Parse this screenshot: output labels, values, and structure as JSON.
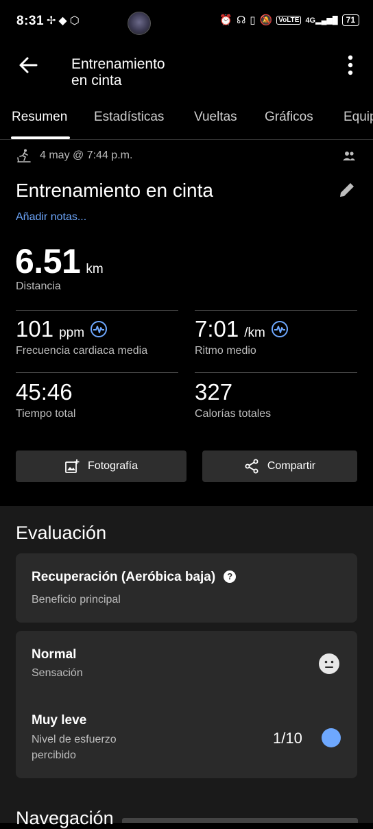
{
  "status_bar": {
    "time": "8:31",
    "left_icons": [
      "fan-icon",
      "badge-icon",
      "shield-icon"
    ],
    "right_icons": [
      "alarm-icon",
      "headphones-icon",
      "vibrate-icon",
      "mute-icon"
    ],
    "volte": "VoLTE",
    "network": "4G",
    "battery": "71"
  },
  "header": {
    "title": "Entrenamiento en cinta"
  },
  "tabs": [
    {
      "label": "Resumen",
      "active": true
    },
    {
      "label": "Estadísticas",
      "active": false
    },
    {
      "label": "Vueltas",
      "active": false
    },
    {
      "label": "Gráficos",
      "active": false
    },
    {
      "label": "Equip",
      "active": false
    }
  ],
  "activity": {
    "datetime": "4 may @ 7:44 p.m.",
    "title": "Entrenamiento en cinta",
    "add_notes": "Añadir notas...",
    "distance_value": "6.51",
    "distance_unit": "km",
    "distance_label": "Distancia",
    "metrics": {
      "heart_rate": {
        "value": "101",
        "unit": "ppm",
        "label": "Frecuencia cardiaca media"
      },
      "pace": {
        "value": "7:01",
        "unit": "/km",
        "label": "Ritmo medio"
      },
      "total_time": {
        "value": "45:46",
        "label": "Tiempo total"
      },
      "calories": {
        "value": "327",
        "label": "Calorías totales"
      }
    }
  },
  "actions": {
    "photo_label": "Fotografía",
    "share_label": "Compartir"
  },
  "evaluation": {
    "title": "Evaluación",
    "benefit": {
      "heading": "Recuperación (Aeróbica baja)",
      "subtitle": "Beneficio principal"
    },
    "feel": {
      "heading": "Normal",
      "subtitle": "Sensación"
    },
    "effort": {
      "heading": "Muy leve",
      "subtitle_line1": "Nivel de esfuerzo",
      "subtitle_line2": "percibido",
      "value": "1/10"
    }
  },
  "next_section_title": "Navegación",
  "colors": {
    "accent": "#6ea8fe",
    "background": "#000000",
    "card": "#2a2a2a"
  }
}
